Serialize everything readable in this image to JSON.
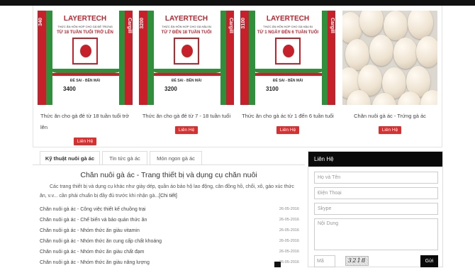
{
  "colors": {
    "accent": "#d9302f",
    "dark": "#0a0a0a",
    "bag_red": "#c8202a",
    "bag_green": "#2f8f3a"
  },
  "products": [
    {
      "caption": "Thức ăn cho gà đẻ từ 18 tuần tuổi trở lên",
      "button": "Liên Hệ",
      "bag": {
        "brand": "LAYERTECH",
        "line1": "THỨC ĂN HỖN HỢP CHO GÀ ĐẺ TRỨNG",
        "line2": "TỪ 18 TUẦN TUỔI TRỞ LÊN",
        "tagline": "ĐẺ SAI - BỀN MÁI",
        "code": "3400",
        "side_left": "340",
        "side_right": "Cargill"
      }
    },
    {
      "caption": "Thức ăn cho gà đẻ từ 7 - 18 tuần tuổi",
      "button": "Liên Hệ",
      "bag": {
        "brand": "LAYERTECH",
        "line1": "THỨC ĂN HỖN HỢP CHO GÀ HẬU BỊ",
        "line2": "TỪ 7 ĐẾN 18 TUẦN TUỔI",
        "tagline": "ĐẺ SAI - BỀN MÁI",
        "code": "3200",
        "side_left": "3200",
        "side_right": "Cargill"
      }
    },
    {
      "caption": "Thức ăn cho gà ác từ 1 đến 6 tuần tuổi",
      "button": "Liên Hệ",
      "bag": {
        "brand": "LAYERTECH",
        "line1": "THỨC ĂN HỖN HỢP CHO GÀ HẬU BỊ",
        "line2": "TỪ 1 NGÀY ĐẾN 6 TUẦN TUỔI",
        "tagline": "ĐẺ SAI - BỀN MÁI",
        "code": "3100",
        "side_left": "3100",
        "side_right": "Cargill"
      }
    },
    {
      "caption": "Chăn nuôi gà ác - Trứng gà ác",
      "button": "Liên Hệ"
    }
  ],
  "tabs": [
    {
      "label": "Kỹ thuật nuôi gà ác"
    },
    {
      "label": "Tin tức gà ác"
    },
    {
      "label": "Món ngon gà ác"
    }
  ],
  "article": {
    "title": "Chăn nuôi gà ác - Trang thiết bị và dụng cụ chăn nuôi",
    "description": "Các trang thiết bị và dụng cụ khác như giày dép, quần áo bảo hộ lao động, cân đồng hồ, chổi, xô, gáo xúc thức ăn, v.v... cần phải chuẩn bị đầy đủ trước khi nhận gà...",
    "more": "[Chi tiết]"
  },
  "news": [
    {
      "title": "Chăn nuôi gà ác - Công việc thiết kế chuồng trại",
      "date": "26-05-2016"
    },
    {
      "title": "Chăn nuôi gà ác - Chế biến và bảo quản thức ăn",
      "date": "26-05-2016"
    },
    {
      "title": "Chăn nuôi gà ác - Nhóm thức ăn giàu vitamin",
      "date": "26-05-2016"
    },
    {
      "title": "Chăn nuôi gà ác - Nhóm thức ăn cung cấp chất khoáng",
      "date": "26-05-2016"
    },
    {
      "title": "Chăn nuôi gà ác - Nhóm thức ăn giàu chất đạm",
      "date": "26-05-2016"
    },
    {
      "title": "Chăn nuôi gà ác - Nhóm thức ăn giàu năng lượng",
      "date": "26-05-2016"
    }
  ],
  "contact": {
    "heading": "Liên Hệ",
    "name_placeholder": "Họ và Tên",
    "phone_placeholder": "Điện Thoại",
    "skype_placeholder": "Skype",
    "content_placeholder": "Nội Dung",
    "captcha_placeholder": "Mã",
    "captcha_code": "3218",
    "send_label": "Gửi"
  }
}
